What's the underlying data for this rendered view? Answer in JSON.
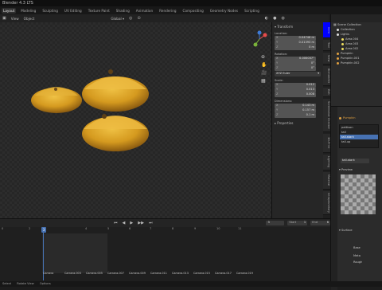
{
  "title": "Blender 4.3 LTS",
  "workspaces": {
    "items": [
      "Layout",
      "Modeling",
      "Sculpting",
      "UV Editing",
      "Texture Paint",
      "Shading",
      "Animation",
      "Rendering",
      "Compositing",
      "Geometry Nodes",
      "Scripting"
    ],
    "active": "Layout"
  },
  "viewport_header": {
    "view": "View",
    "object_menu": "Object",
    "transform": "Global",
    "options": "Options"
  },
  "npanel": {
    "section_transform": "Transform",
    "location": {
      "label": "Location:",
      "x": "0.04746 m",
      "y": "0.01393 m",
      "z": "0 m"
    },
    "rotation": {
      "label": "Rotation:",
      "x": "0.000037°",
      "y": "0°",
      "z": "0°",
      "mode": "XYZ Euler"
    },
    "scale": {
      "label": "Scale:",
      "x": "0.012",
      "y": "0.013",
      "z": "0.008"
    },
    "dimensions": {
      "label": "Dimensions:",
      "x": "0.143 m",
      "y": "0.157 m",
      "z": "0.1 m"
    },
    "properties": "Properties",
    "axis": [
      "X",
      "Y",
      "Z"
    ]
  },
  "side_tabs": [
    "Item",
    "Tool",
    "View",
    "BlenderKit",
    "Edit",
    "Screenshot Checker",
    "3D-Print",
    "Lighting",
    "Material",
    "Intraplanetary"
  ],
  "outliner": {
    "title": "Scene Collection",
    "rows": [
      "Collection",
      "Lights",
      "Area.004",
      "Area.003",
      "Area.002",
      "Pumpkin",
      "Pumpkin.001",
      "Pumpkin.002"
    ]
  },
  "properties": {
    "object": "Pumpkin",
    "shape_keys": [
      "pattison",
      "tall",
      "tall.stark",
      "tall.up"
    ],
    "active_key": "tall.stark",
    "preview": "Preview",
    "surface": "Surface",
    "labels": [
      "Base",
      "Meta",
      "Rough"
    ],
    "offset": "Offsets"
  },
  "timeline": {
    "current": "3",
    "start_label": "Start",
    "start": "1",
    "end_label": "End",
    "end": "6",
    "ticks": [
      "0",
      "2",
      "3",
      "4",
      "5",
      "6",
      "7",
      "8",
      "9",
      "10",
      "11"
    ],
    "markers": [
      "Camera",
      "Camera.003",
      "Camera.005",
      "Camera.007",
      "Camera.009",
      "Camera.011",
      "Camera.013",
      "Camera.015",
      "Camera.017",
      "Camera.019"
    ]
  },
  "status": {
    "item1": "Select",
    "item2": "Rotate View",
    "item3": "Options"
  }
}
